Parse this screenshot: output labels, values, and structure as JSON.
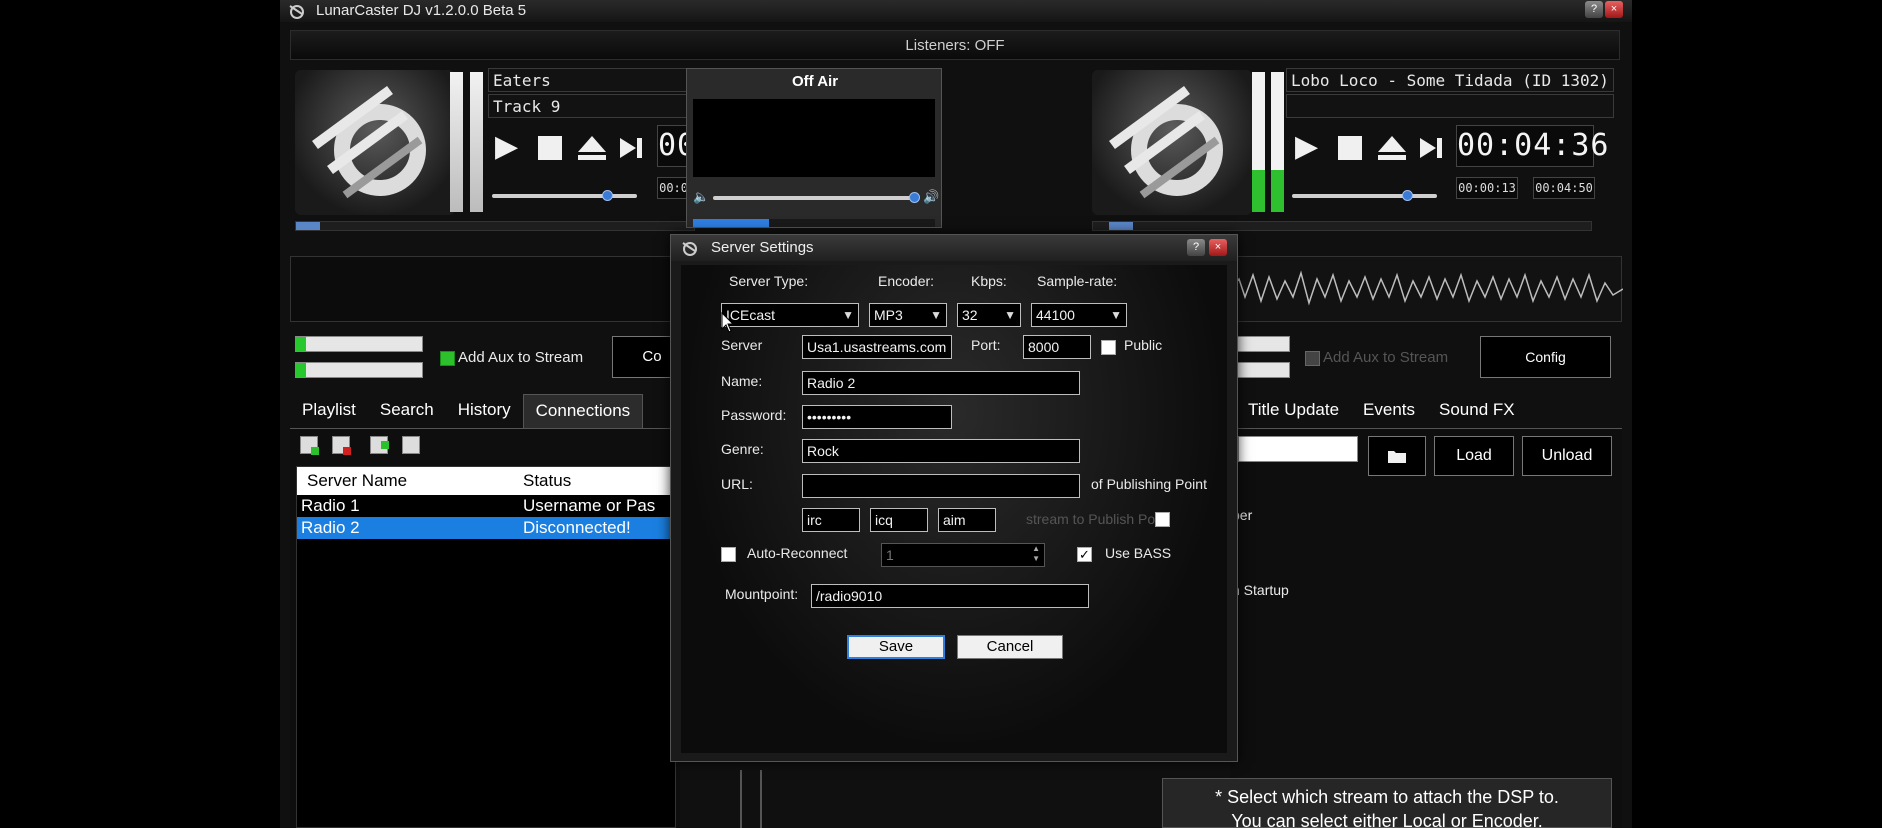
{
  "app": {
    "title": "LunarCaster DJ v1.2.0.0 Beta 5",
    "help": "?",
    "close": "×"
  },
  "listeners": "Listeners: OFF",
  "deck_left": {
    "line1": "Eaters",
    "line2": "Track 9",
    "time_big": "00:00:00",
    "time_small_1": "00:00:00",
    "time_small_2": ""
  },
  "onair": {
    "label": "Off Air"
  },
  "deck_right": {
    "line1": "Lobo Loco - Some Tidada (ID 1302)",
    "line2": "",
    "time_big": "00:04:36",
    "time_small_1": "00:00:13",
    "time_small_2": "00:04:50"
  },
  "left_panel": {
    "aux_label": "Add Aux to Stream",
    "config_partial": "Co"
  },
  "right_panel": {
    "aux_label": "Add Aux to Stream",
    "config": "Config"
  },
  "tabs_left": [
    "Playlist",
    "Search",
    "History",
    "Connections"
  ],
  "tabs_right": [
    "Title Update",
    "Events",
    "Sound FX"
  ],
  "connections": {
    "headers": [
      "Server Name",
      "Status"
    ],
    "rows": [
      {
        "name": "Radio 1",
        "status": "Username or Pas"
      },
      {
        "name": "Radio 2",
        "status": "Disconnected!"
      }
    ]
  },
  "right_controls": {
    "load": "Load",
    "unload": "Unload",
    "frag1": "ber",
    "frag2": "n Startup",
    "frag3": "r"
  },
  "hint": {
    "line1": "* Select which stream to attach the DSP to.",
    "line2": "You can select either Local or Encoder."
  },
  "dialog": {
    "title": "Server Settings",
    "labels": {
      "server_type": "Server Type:",
      "encoder": "Encoder:",
      "kbps": "Kbps:",
      "sample_rate": "Sample-rate:",
      "server": "Server",
      "port": "Port:",
      "public": "Public",
      "name": "Name:",
      "password": "Password:",
      "genre": "Genre:",
      "url": "URL:",
      "publishing": "of Publishing Point",
      "stream_to_publish": "stream to Publish Point",
      "auto_reconnect": "Auto-Reconnect",
      "use_bass": "Use BASS",
      "mountpoint": "Mountpoint:"
    },
    "values": {
      "server_type": "ICEcast",
      "encoder": "MP3",
      "kbps": "32",
      "sample_rate": "44100",
      "server": "Usa1.usastreams.com",
      "port": "8000",
      "name": "Radio 2",
      "password": "•••••••••",
      "genre": "Rock",
      "url": "",
      "irc": "irc",
      "icq": "icq",
      "aim": "aim",
      "reconnect_value": "1",
      "mountpoint": "/radio9010"
    },
    "public_checked": false,
    "auto_reconnect_checked": false,
    "use_bass_checked": true,
    "save": "Save",
    "cancel": "Cancel"
  }
}
